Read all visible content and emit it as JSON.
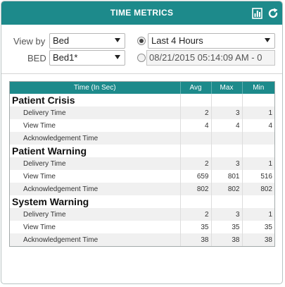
{
  "header": {
    "title": "TIME METRICS",
    "icons": [
      "bar-chart-icon",
      "refresh-icon"
    ],
    "accent_color": "#1d8a8b"
  },
  "filters": {
    "view_by_label": "View by",
    "view_by_value": "Bed",
    "bed_label": "BED",
    "bed_value": "Bed1*",
    "range_value": "Last 4 Hours",
    "range_selected": true,
    "date_value": "08/21/2015 05:14:09 AM - 0",
    "date_selected": false
  },
  "table": {
    "columns": [
      "Time (In Sec)",
      "Avg",
      "Max",
      "Min"
    ],
    "groups": [
      {
        "name": "Patient Crisis",
        "rows": [
          {
            "label": "Delivery Time",
            "avg": "2",
            "max": "3",
            "min": "1"
          },
          {
            "label": "View Time",
            "avg": "4",
            "max": "4",
            "min": "4"
          },
          {
            "label": "Acknowledgement Time",
            "avg": "",
            "max": "",
            "min": ""
          }
        ]
      },
      {
        "name": "Patient Warning",
        "rows": [
          {
            "label": "Delivery Time",
            "avg": "2",
            "max": "3",
            "min": "1"
          },
          {
            "label": "View Time",
            "avg": "659",
            "max": "801",
            "min": "516"
          },
          {
            "label": "Acknowledgement Time",
            "avg": "802",
            "max": "802",
            "min": "802"
          }
        ]
      },
      {
        "name": "System Warning",
        "rows": [
          {
            "label": "Delivery Time",
            "avg": "2",
            "max": "3",
            "min": "1"
          },
          {
            "label": "View Time",
            "avg": "35",
            "max": "35",
            "min": "35"
          },
          {
            "label": "Acknowledgement Time",
            "avg": "38",
            "max": "38",
            "min": "38"
          }
        ]
      }
    ]
  }
}
